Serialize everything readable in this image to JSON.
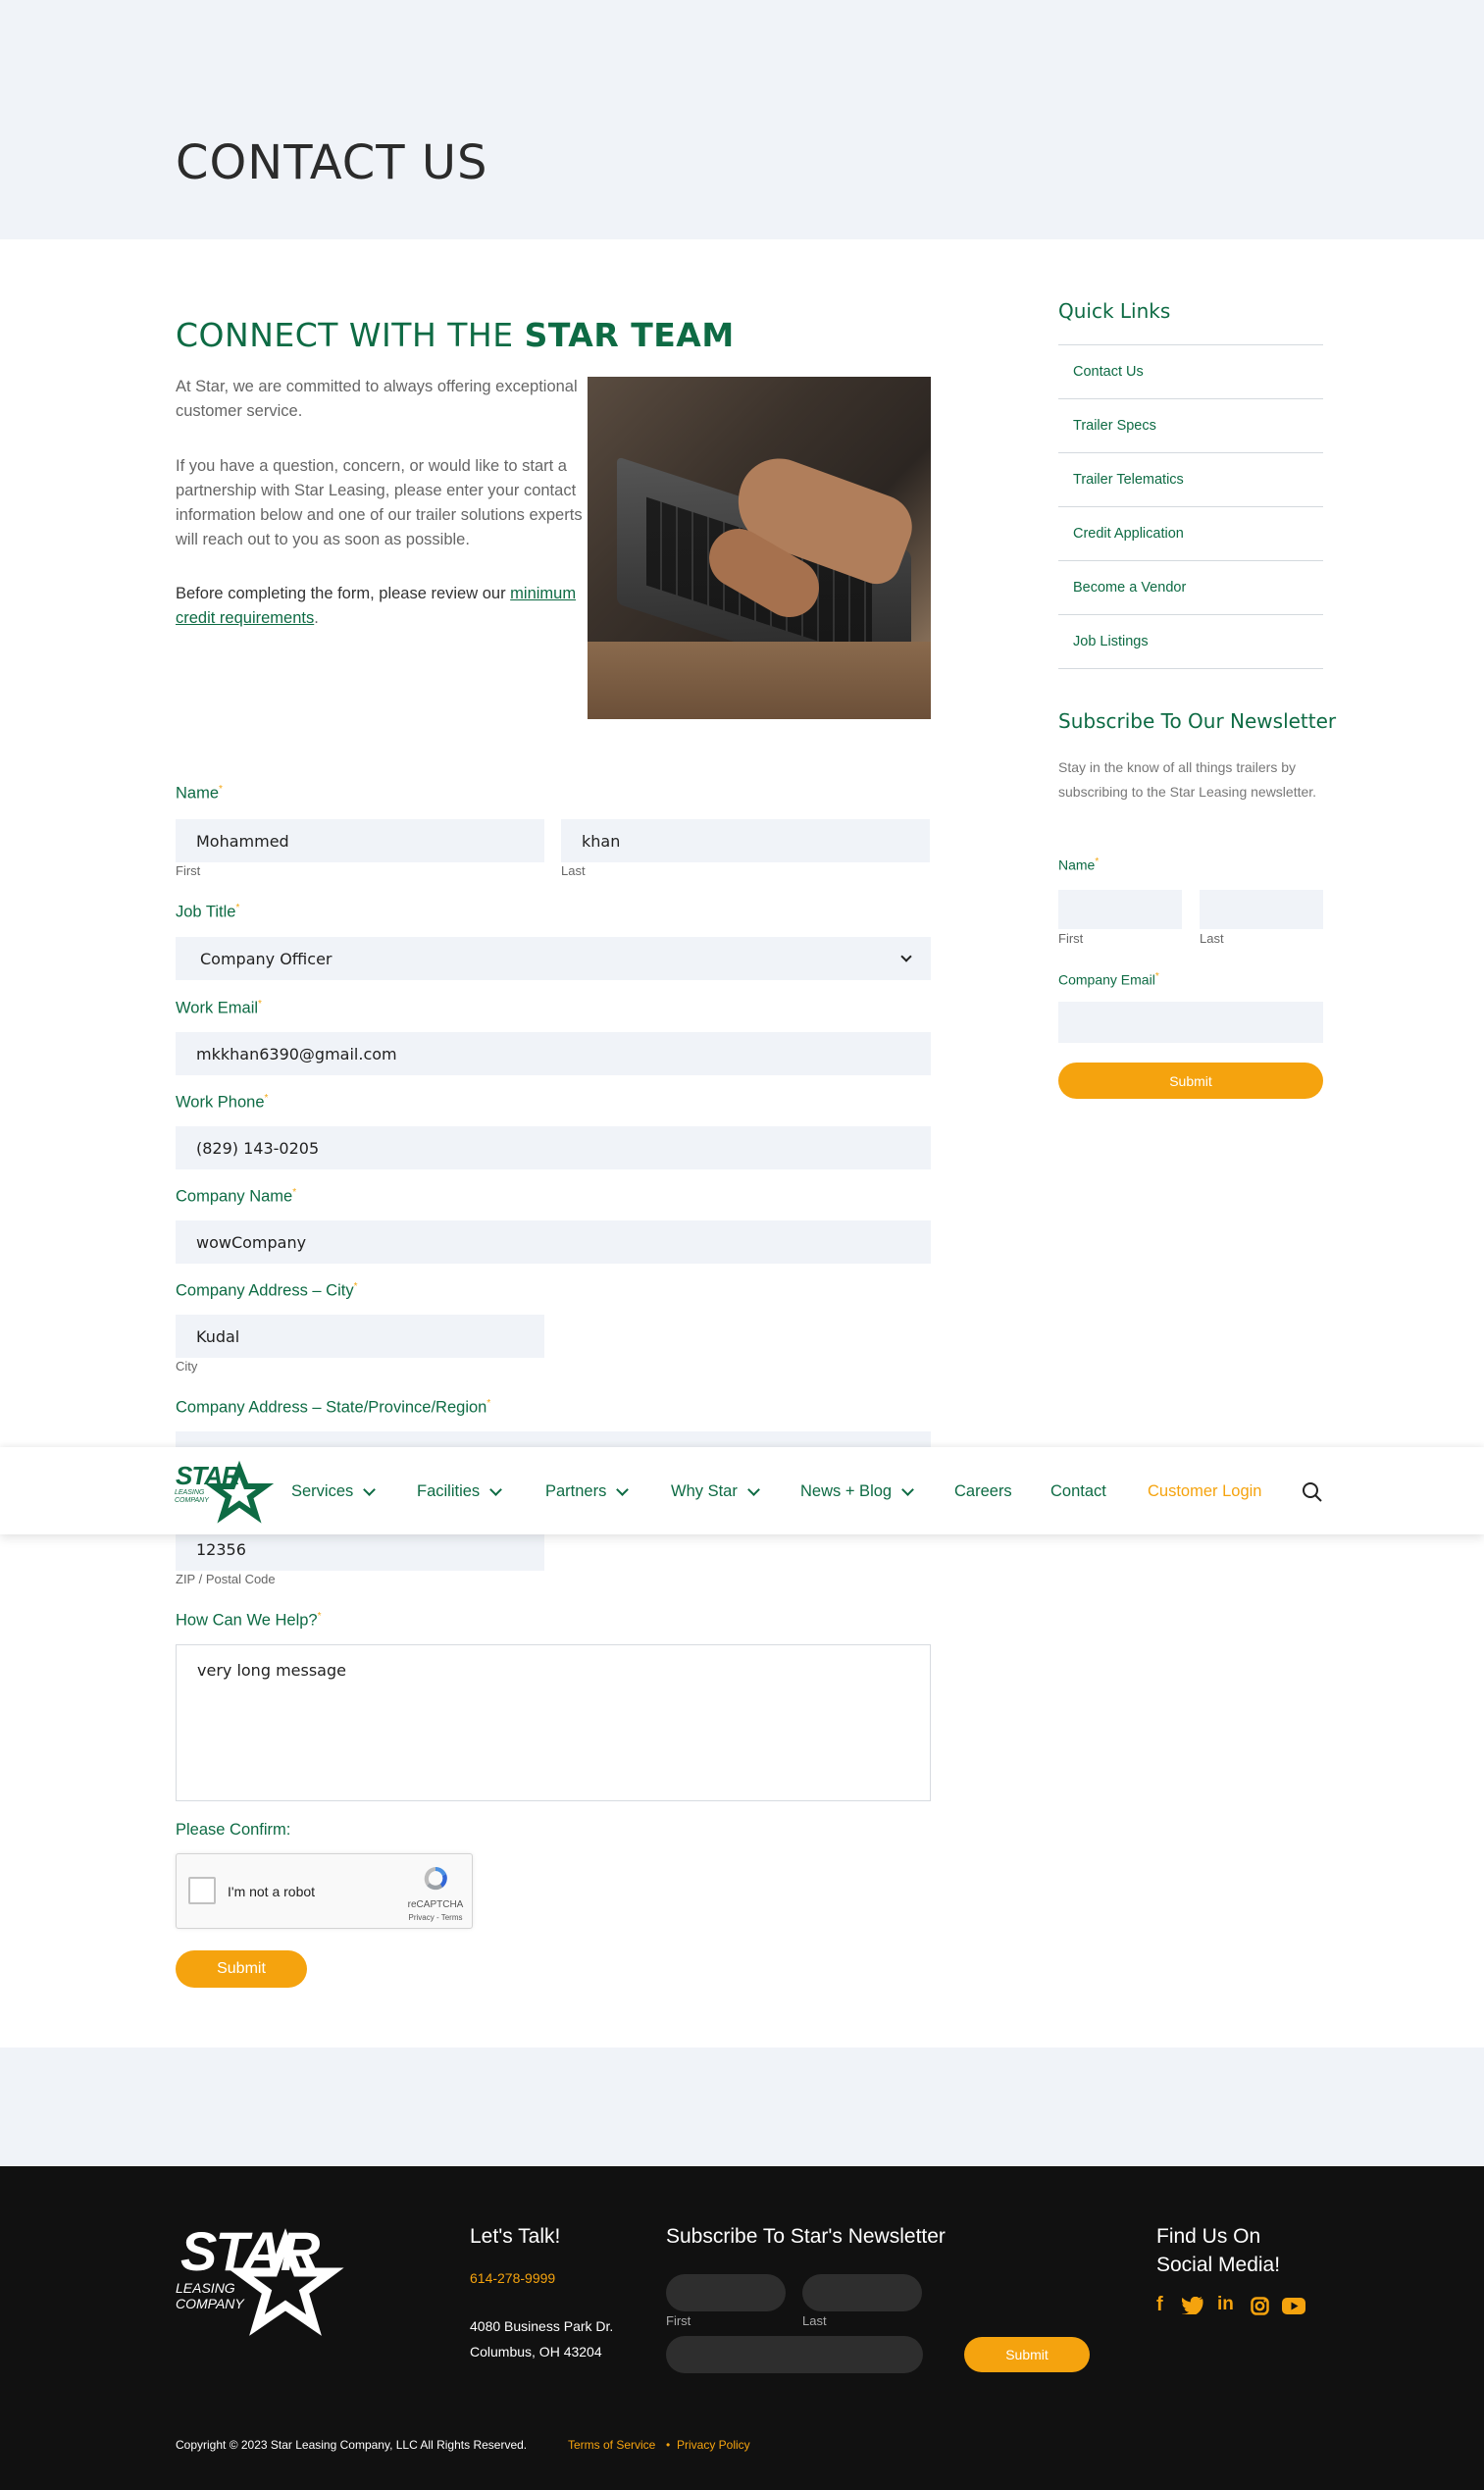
{
  "page": {
    "title": "CONTACT US"
  },
  "intro": {
    "heading_plain": "CONNECT WITH THE ",
    "heading_bold": "STAR TEAM",
    "p1": "At Star, we are committed to always offering exceptional customer service.",
    "p2": "If you have a question, concern, or would like to start a partnership with Star Leasing, please enter your contact information below and one of our trailer solutions experts will reach out to you as soon as possible.",
    "p3_text": "Before completing the form, please review our ",
    "p3_link": "minimum credit requirements",
    "p3_end": "."
  },
  "form": {
    "name_label": "Name",
    "first_value": "Mohammed",
    "first_sub": "First",
    "last_value": "khan",
    "last_sub": "Last",
    "job_label": "Job Title",
    "job_value": "Company Officer",
    "email_label": "Work Email",
    "email_value": "mkkhan6390@gmail.com",
    "phone_label": "Work Phone",
    "phone_value": "(829) 143-0205",
    "company_label": "Company Name",
    "company_value": "wowCompany",
    "city_label": "Company Address – City",
    "city_value": "Kudal",
    "city_sub": "City",
    "state_label": "Company Address – State/Province/Region",
    "zip_value": "12356",
    "zip_sub": "ZIP / Postal Code",
    "help_label": "How Can We Help?",
    "help_value": "very long message",
    "confirm_label": "Please Confirm:",
    "captcha_text": "I'm not a robot",
    "captcha_brand": "reCAPTCHA",
    "captcha_links": "Privacy - Terms",
    "submit": "Submit",
    "required_mark": "*"
  },
  "sidebar": {
    "quick_links_title": "Quick Links",
    "links": [
      "Contact Us",
      "Trailer Specs",
      "Trailer Telematics",
      "Credit Application",
      "Become a Vendor",
      "Job Listings"
    ],
    "newsletter_title": "Subscribe To Our Newsletter",
    "newsletter_text": "Stay in the know of all things trailers by subscribing to the Star Leasing newsletter.",
    "name_label": "Name",
    "first_sub": "First",
    "last_sub": "Last",
    "email_label": "Company Email",
    "submit": "Submit"
  },
  "nav": {
    "logo_text": "STAR",
    "logo_sub1": "LEASING",
    "logo_sub2": "COMPANY",
    "items": [
      "Services",
      "Facilities",
      "Partners",
      "Why Star",
      "News + Blog",
      "Careers",
      "Contact",
      "Customer Login"
    ]
  },
  "footer": {
    "logo_text": "STAR",
    "logo_sub1": "LEASING",
    "logo_sub2": "COMPANY",
    "talk_title": "Let's Talk!",
    "phone": "614-278-9999",
    "address1": "4080 Business Park Dr.",
    "address2": "Columbus, OH 43204",
    "newsletter_title": "Subscribe To Star's Newsletter",
    "first_sub": "First",
    "last_sub": "Last",
    "submit": "Submit",
    "social_title1": "Find Us On",
    "social_title2": "Social Media!",
    "social_icons": [
      "facebook-icon",
      "twitter-icon",
      "linkedin-icon",
      "instagram-icon",
      "youtube-icon"
    ],
    "copyright": "Copyright © 2023 Star Leasing Company, LLC All Rights Reserved.",
    "terms": "Terms of Service",
    "separator": "•",
    "privacy": "Privacy Policy"
  },
  "colors": {
    "brand_green": "#0e6b44",
    "accent_orange": "#f5a30e",
    "panel_bg": "#f0f3f8",
    "footer_bg": "#111111"
  }
}
